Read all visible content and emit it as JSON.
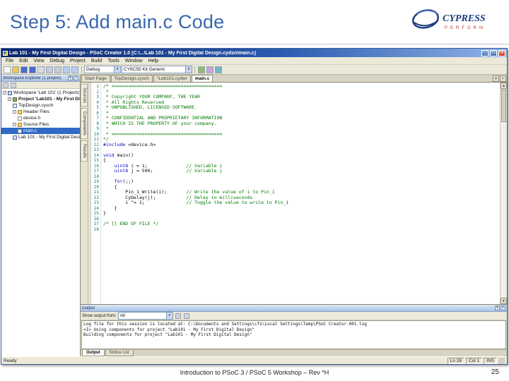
{
  "slide": {
    "title": "Step 5: Add main.c Code",
    "footer": "Introduction to PSoC 3 / PSoC 5 Workshop – Rev *H",
    "page_number": "25"
  },
  "logo": {
    "brand": "CYPRESS",
    "tagline": "PERFORM"
  },
  "window": {
    "title": "Lab 101 - My First Digital Design - PSoC Creator 1.0  [C:\\...\\Lab 101 - My First Digital Design.cydsn\\main.c]",
    "menu_items": [
      "File",
      "Edit",
      "View",
      "Debug",
      "Project",
      "Build",
      "Tools",
      "Window",
      "Help"
    ],
    "toolbar": {
      "icons": [
        "new-file",
        "open-file",
        "save",
        "save-all",
        "cut",
        "copy",
        "paste",
        "undo",
        "redo"
      ],
      "config_combo": "Debug",
      "target_combo": "CY8C55 Kit Generic",
      "right_icons": [
        "build",
        "program",
        "debug"
      ]
    }
  },
  "workspace": {
    "header": "Workspace Explorer (1 project)",
    "toolbar_icons": [
      "collapse-all",
      "show-all"
    ],
    "tree": [
      {
        "label": "Workspace 'Lab 101' (1 Projects)",
        "indent": 0,
        "icon": "workspace",
        "expander": true
      },
      {
        "label": "Project 'Lab101 - My First Digital Design'",
        "indent": 1,
        "icon": "project",
        "expander": true,
        "bold": true
      },
      {
        "label": "TopDesign.cysch",
        "indent": 2,
        "icon": "schematic"
      },
      {
        "label": "Header Files",
        "indent": 2,
        "icon": "folder",
        "expander": true
      },
      {
        "label": "device.h",
        "indent": 3,
        "icon": "file"
      },
      {
        "label": "Source Files",
        "indent": 2,
        "icon": "folder",
        "expander": true
      },
      {
        "label": "main.c",
        "indent": 3,
        "icon": "file",
        "selected": true
      },
      {
        "label": "Lab 101 - My First Digital Design.cydwr",
        "indent": 2,
        "icon": "resource"
      }
    ]
  },
  "editor": {
    "tabs": [
      {
        "label": "Start Page"
      },
      {
        "label": "TopDesign.cysch"
      },
      {
        "label": "*Lab101.cydwr"
      },
      {
        "label": "main.c",
        "active": true
      }
    ],
    "side_tabs": [
      "Sources",
      "Components",
      "Results"
    ],
    "lines": [
      {
        "n": "1",
        "segs": [
          {
            "c": "com",
            "t": "/* ========================================"
          }
        ]
      },
      {
        "n": "2",
        "segs": [
          {
            "c": "com",
            "t": " *"
          }
        ]
      },
      {
        "n": "3",
        "segs": [
          {
            "c": "com",
            "t": " * Copyright YOUR COMPANY, THE YEAR"
          }
        ]
      },
      {
        "n": "4",
        "segs": [
          {
            "c": "com",
            "t": " * All Rights Reserved"
          }
        ]
      },
      {
        "n": "5",
        "segs": [
          {
            "c": "com",
            "t": " * UNPUBLISHED, LICENSED SOFTWARE."
          }
        ]
      },
      {
        "n": "6",
        "segs": [
          {
            "c": "com",
            "t": " *"
          }
        ]
      },
      {
        "n": "7",
        "segs": [
          {
            "c": "com",
            "t": " * CONFIDENTIAL AND PROPRIETARY INFORMATION"
          }
        ]
      },
      {
        "n": "8",
        "segs": [
          {
            "c": "com",
            "t": " * WHICH IS THE PROPERTY OF your company."
          }
        ]
      },
      {
        "n": "9",
        "segs": [
          {
            "c": "com",
            "t": " *"
          }
        ]
      },
      {
        "n": "10",
        "segs": [
          {
            "c": "com",
            "t": " * ========================================"
          }
        ]
      },
      {
        "n": "11",
        "segs": [
          {
            "c": "com",
            "t": "*/"
          }
        ]
      },
      {
        "n": "12",
        "segs": [
          {
            "c": "kw",
            "t": "#include"
          },
          {
            "c": "code-seg",
            "t": " <device.h>"
          }
        ]
      },
      {
        "n": "13",
        "segs": []
      },
      {
        "n": "14",
        "segs": [
          {
            "c": "kw",
            "t": "void"
          },
          {
            "c": "code-seg",
            "t": " main()"
          }
        ]
      },
      {
        "n": "15",
        "segs": [
          {
            "c": "code-seg",
            "t": "{"
          }
        ]
      },
      {
        "n": "16",
        "segs": [
          {
            "c": "code-seg",
            "t": "    "
          },
          {
            "c": "kw",
            "t": "uint8"
          },
          {
            "c": "code-seg",
            "t": " i = 1;"
          },
          {
            "c": "com",
            "t": "              // Variable i"
          }
        ]
      },
      {
        "n": "17",
        "segs": [
          {
            "c": "code-seg",
            "t": "    "
          },
          {
            "c": "kw",
            "t": "uint8"
          },
          {
            "c": "code-seg",
            "t": " j = 500;"
          },
          {
            "c": "com",
            "t": "            // Variable j"
          }
        ]
      },
      {
        "n": "18",
        "segs": []
      },
      {
        "n": "19",
        "segs": [
          {
            "c": "code-seg",
            "t": "    "
          },
          {
            "c": "kw",
            "t": "for"
          },
          {
            "c": "code-seg",
            "t": "(;;)"
          }
        ]
      },
      {
        "n": "20",
        "segs": [
          {
            "c": "code-seg",
            "t": "    {"
          }
        ]
      },
      {
        "n": "21",
        "segs": [
          {
            "c": "code-seg",
            "t": "        Pin_1_Write(i);"
          },
          {
            "c": "com",
            "t": "       // Write the value of i to Pin_1"
          }
        ]
      },
      {
        "n": "22",
        "segs": [
          {
            "c": "code-seg",
            "t": "        CyDelay(j);"
          },
          {
            "c": "com",
            "t": "           // Delay in milliseconds"
          }
        ]
      },
      {
        "n": "23",
        "segs": [
          {
            "c": "code-seg",
            "t": "        i ^= 1;"
          },
          {
            "c": "com",
            "t": "               // Toggle the value to write to Pin_1"
          }
        ]
      },
      {
        "n": "24",
        "segs": [
          {
            "c": "code-seg",
            "t": "    }"
          }
        ]
      },
      {
        "n": "25",
        "segs": [
          {
            "c": "code-seg",
            "t": "}"
          }
        ]
      },
      {
        "n": "26",
        "segs": []
      },
      {
        "n": "27",
        "segs": [
          {
            "c": "com",
            "t": "/* [] END OF FILE */"
          }
        ]
      },
      {
        "n": "28",
        "segs": []
      }
    ]
  },
  "output": {
    "header": "Output",
    "show_label": "Show output from:",
    "combo": "All",
    "log": [
      "Log file for this session is located at: C:\\Documents and Settings\\cfs\\Local Settings\\Temp\\PSoC Creator-001.log",
      "<I> Using components for project \"Lab101 - My First Digital Design\"",
      "Building components for project \"Lab101 - My First Digital Design\""
    ],
    "tabs": [
      {
        "label": "Output",
        "active": true
      },
      {
        "label": "Notice List"
      }
    ]
  },
  "statusbar": {
    "left": "Ready",
    "items": [
      "Ln 28",
      "Col 1",
      "INS"
    ]
  }
}
